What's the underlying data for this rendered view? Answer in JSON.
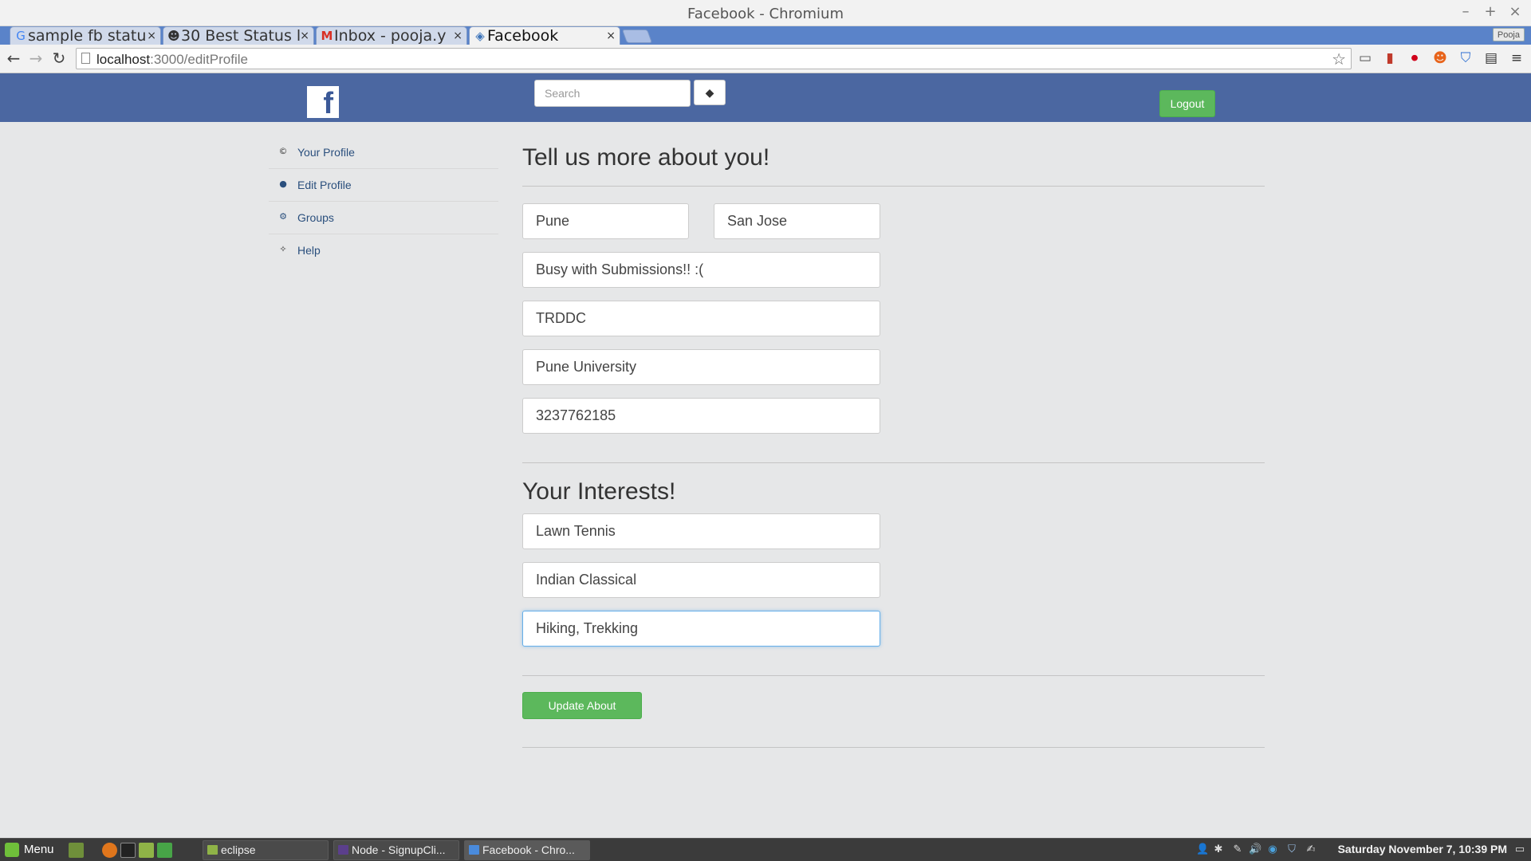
{
  "window": {
    "title": "Facebook - Chromium",
    "controls": [
      "–",
      "+",
      "×"
    ]
  },
  "tabs": [
    {
      "label": "sample fb statu",
      "favicon": "google-icon",
      "favicon_glyph": "G",
      "active": false
    },
    {
      "label": "30 Best Status l",
      "favicon": "emoji-icon",
      "favicon_glyph": "☻",
      "active": false
    },
    {
      "label": "Inbox - pooja.y",
      "favicon": "gmail-icon",
      "favicon_glyph": "M",
      "active": false
    },
    {
      "label": "Facebook",
      "favicon": "app-icon",
      "favicon_glyph": "◈",
      "active": true
    }
  ],
  "tab_close_glyph": "×",
  "profile_badge": "Pooja",
  "toolbar": {
    "back_glyph": "←",
    "forward_glyph": "→",
    "reload_glyph": "↻",
    "url_host": "localhost",
    "url_path": ":3000/editProfile",
    "star_glyph": "☆",
    "extensions": [
      "▭",
      "▮",
      "⏺",
      "☻",
      "⛉",
      "▤",
      "≡"
    ]
  },
  "fb_header": {
    "logo_letter": "f",
    "search_placeholder": "Search",
    "search_button_glyph": "◆",
    "logout_label": "Logout"
  },
  "sidebar": {
    "items": [
      {
        "label": "Your Profile",
        "icon": "copyright-icon",
        "glyph": "©"
      },
      {
        "label": "Edit Profile",
        "icon": "record-icon",
        "glyph": "●"
      },
      {
        "label": "Groups",
        "icon": "gear-icon",
        "glyph": "⚙"
      },
      {
        "label": "Help",
        "icon": "lightbulb-icon",
        "glyph": "✧"
      }
    ]
  },
  "about": {
    "heading": "Tell us more about you!",
    "hometown": "Pune",
    "current_city": "San Jose",
    "status": "Busy with Submissions!! :(",
    "workplace": "TRDDC",
    "education": "Pune University",
    "phone": "3237762185"
  },
  "interests": {
    "heading": "Your Interests!",
    "values": [
      "Lawn Tennis",
      "Indian Classical",
      "Hiking, Trekking"
    ]
  },
  "update_button_label": "Update About",
  "taskbar": {
    "menu_label": "Menu",
    "tasks": [
      "eclipse",
      "Node - SignupCli...",
      "Facebook - Chro..."
    ],
    "tray_glyphs": [
      "👤",
      "✱",
      "✎",
      "🔊",
      "◉",
      "⛉",
      "✍",
      "▭"
    ],
    "clock": "Saturday November  7, 10:39 PM"
  },
  "colors": {
    "fb_blue": "#4b67a1",
    "success_green": "#5cb85c",
    "page_bg": "#e6e7e8"
  }
}
